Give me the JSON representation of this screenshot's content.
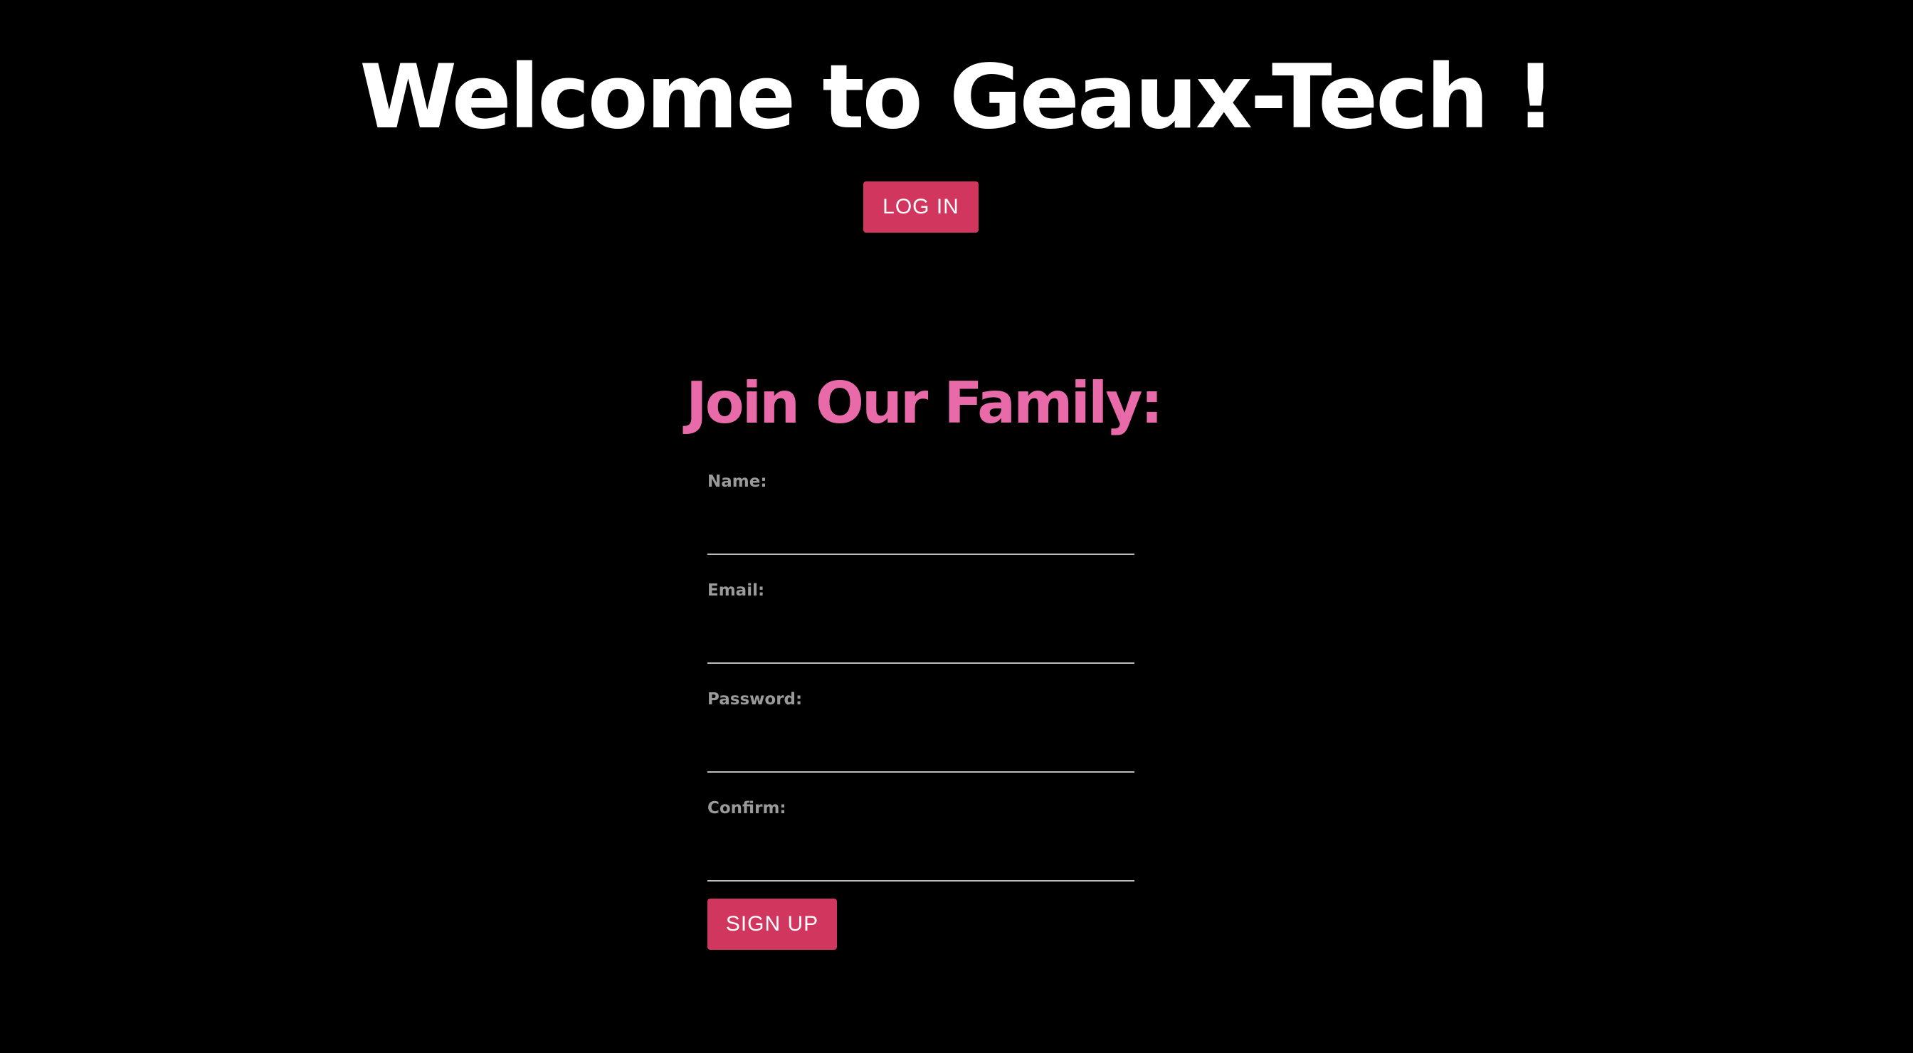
{
  "header": {
    "title": "Welcome to Geaux-Tech !",
    "login_label": "LOG IN"
  },
  "signup_form": {
    "title": "Join Our Family:",
    "fields": [
      {
        "label": "Name:",
        "value": "",
        "placeholder": ""
      },
      {
        "label": "Email:",
        "value": "",
        "placeholder": ""
      },
      {
        "label": "Password:",
        "value": "",
        "placeholder": ""
      },
      {
        "label": "Confirm:",
        "value": "",
        "placeholder": ""
      }
    ],
    "submit_label": "SIGN UP"
  },
  "colors": {
    "background": "#000000",
    "title": "#ffffff",
    "accent_button": "#d1365f",
    "form_title": "#e96aa9",
    "field_label": "#9a9a9a",
    "field_underline": "#bdbdbd"
  }
}
